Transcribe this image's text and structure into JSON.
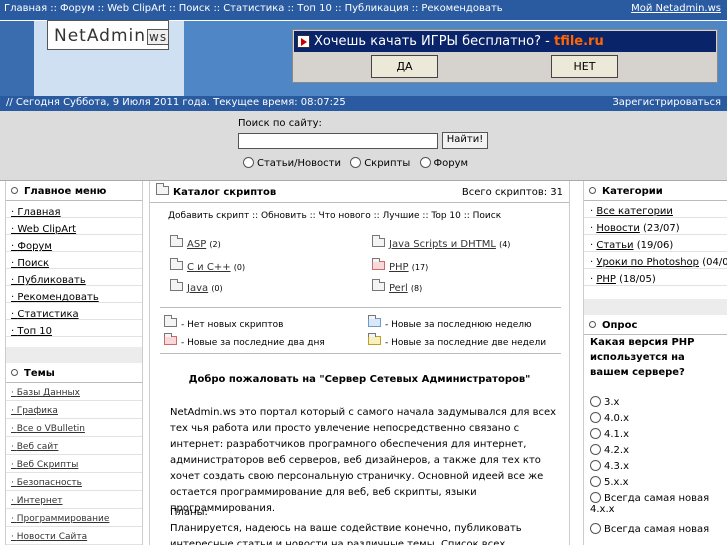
{
  "topnav": {
    "items": [
      "Главная",
      "Форум",
      "Web ClipArt",
      "Поиск",
      "Статистика",
      "Топ 10",
      "Публикация",
      "Рекомендовать"
    ],
    "separator": "::",
    "my_site": "Мой Netadmin.ws"
  },
  "logo": {
    "text": "NetAdmin",
    "suffix": "ws"
  },
  "banner": {
    "question": "Хочешь качать  ИГРЫ  бесплатно? -",
    "brand": "tfile.ru",
    "yes_label": "ДА",
    "no_label": "НЕТ"
  },
  "datebar": {
    "date_text": "// Сегодня Суббота, 9 Июля 2011 года. Текущее время: 08:07:25",
    "register_text": "Зарегистрироваться"
  },
  "search": {
    "label": "Поиск по сайту:",
    "value": "",
    "button_label": "Найти!",
    "options": [
      "Статьи/Новости",
      "Скрипты",
      "Форум"
    ]
  },
  "main_menu": {
    "title": "Главное меню",
    "items": [
      "Главная",
      "Web ClipArt",
      "Форум",
      "Поиск",
      "Публиковать",
      "Рекомендовать",
      "Статистика",
      "Топ 10"
    ]
  },
  "topics": {
    "title": "Темы",
    "items": [
      "Базы Данных",
      "Графика",
      "Все о VBulletin",
      "Веб сайт",
      "Веб Скрипты",
      "Безопасность",
      "Интернет",
      "Программирование",
      "Новости Сайта"
    ]
  },
  "catalog": {
    "title": "Каталог скриптов",
    "total": "Всего скриптов: 31",
    "actions": "Добавить скрипт :: Обновить :: Что нового :: Лучшие :: Top 10 :: Поиск",
    "categories": [
      {
        "name": "ASP",
        "count": "(2)"
      },
      {
        "name": "Java Scripts и DHTML",
        "count": "(4)"
      },
      {
        "name": "С и С++",
        "count": "(0)"
      },
      {
        "name": "PHP",
        "count": "(17)"
      },
      {
        "name": "Java",
        "count": "(0)"
      },
      {
        "name": "Perl",
        "count": "(8)"
      }
    ],
    "legend": [
      "- Нет новых скриптов",
      "- Новые за последнюю неделю",
      "- Новые за последние два дня",
      "- Новые за последние две недели"
    ],
    "welcome": "Добро пожаловать на \"Сервер Сетевых Администраторов\"",
    "intro": "NetAdmin.ws это портал который с самого начала задумывался для всех тех чья работа или просто увлечение непосредственно связано с интернет: разработчиков програмного обеспечения для интернет, администраторов веб серверов, веб дизайнеров, а также для тех кто хочет создать свою персональную страничку. Основной идеей все же остается программирование для веб, веб скрипты, языки программирования.",
    "plans_label": "Планы:",
    "plans_text": "Планируется, надеюсь на ваше содействие конечно, публиковать интересные статьи и новости на различные темы. Список всех доступных тем перечислен в"
  },
  "categories": {
    "title": "Категории",
    "items": [
      {
        "name": "Все категории",
        "count": ""
      },
      {
        "name": "Новости",
        "count": "(23/07)"
      },
      {
        "name": "Статьи",
        "count": "(19/06)"
      },
      {
        "name": "Уроки по Photoshop",
        "count": "(04/07)"
      },
      {
        "name": "PHP",
        "count": "(18/05)"
      }
    ]
  },
  "poll": {
    "title": "Опрос",
    "question": "Какая версия PHP используется на вашем сервере?",
    "options": [
      "3.x",
      "4.0.x",
      "4.1.x",
      "4.2.x",
      "4.3.x",
      "5.x.x",
      "Всегда самая новая 4.x.x",
      "Всегда самая новая"
    ]
  }
}
